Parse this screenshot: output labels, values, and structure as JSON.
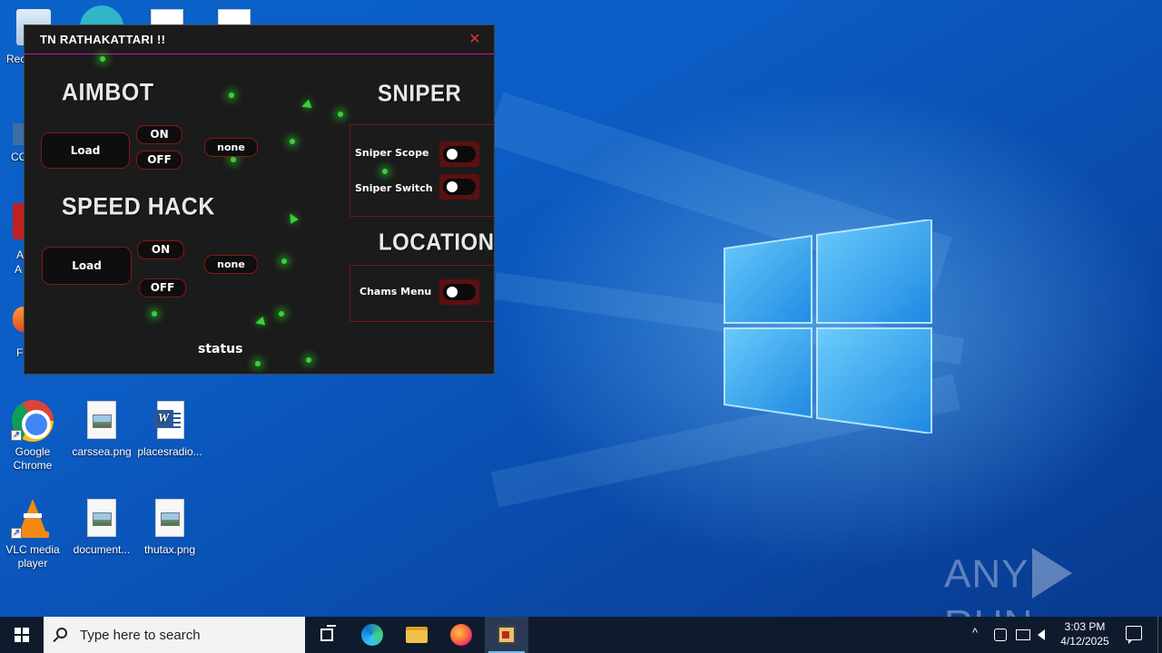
{
  "desktop": {
    "icons": [
      {
        "label": "Google Chrome",
        "type": "chrome"
      },
      {
        "label": "carssea.png",
        "type": "image"
      },
      {
        "label": "placesradio...",
        "type": "word"
      },
      {
        "label": "VLC media player",
        "type": "vlc"
      },
      {
        "label": "document...",
        "type": "image"
      },
      {
        "label": "thutax.png",
        "type": "image"
      }
    ],
    "peek_labels": {
      "recycle": "Rec",
      "cc": "CC",
      "a": "A",
      "a2": "A",
      "f": "F"
    },
    "watermark": {
      "left": "ANY",
      "right": "RUN"
    }
  },
  "cheat_window": {
    "title": "TN RATHAKATTARI !!",
    "close_glyph": "✕",
    "aimbot": {
      "heading": "AIMBOT",
      "load_label": "Load",
      "on_label": "ON",
      "off_label": "OFF",
      "value": "none"
    },
    "speed_hack": {
      "heading": "SPEED HACK",
      "load_label": "Load",
      "on_label": "ON",
      "off_label": "OFF",
      "value": "none"
    },
    "sniper": {
      "heading": "SNIPER",
      "toggles": [
        {
          "label": "Sniper Scope",
          "on": false
        },
        {
          "label": "Sniper Switch",
          "on": false
        }
      ]
    },
    "location": {
      "heading": "LOCATION",
      "toggles": [
        {
          "label": "Chams Menu",
          "on": false
        }
      ]
    },
    "status_label": "status"
  },
  "taskbar": {
    "search_placeholder": "Type here to search",
    "time": "3:03 PM",
    "date": "4/12/2025",
    "tray_chevron": "^"
  },
  "colors": {
    "accent_border": "#c21ca6",
    "button_border": "#8a1515",
    "window_bg": "#1b1b1b",
    "spark_green": "#3ad13a",
    "taskbar_bg": "#0f1b2d"
  }
}
